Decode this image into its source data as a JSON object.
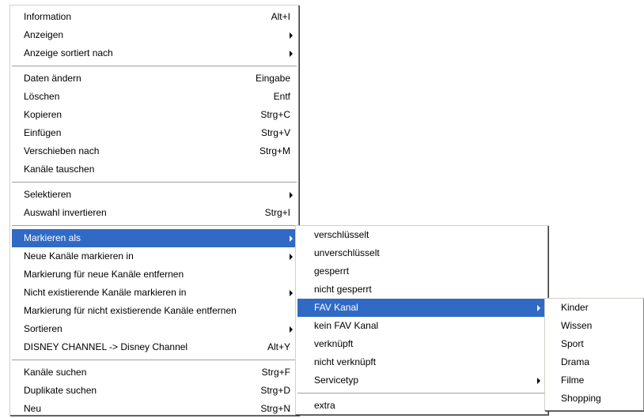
{
  "main_menu": {
    "groups": [
      [
        {
          "label": "Information",
          "shortcut": "Alt+I",
          "submenu": false
        },
        {
          "label": "Anzeigen",
          "shortcut": "",
          "submenu": true
        },
        {
          "label": "Anzeige sortiert nach",
          "shortcut": "",
          "submenu": true
        }
      ],
      [
        {
          "label": "Daten ändern",
          "shortcut": "Eingabe",
          "submenu": false
        },
        {
          "label": "Löschen",
          "shortcut": "Entf",
          "submenu": false
        },
        {
          "label": "Kopieren",
          "shortcut": "Strg+C",
          "submenu": false
        },
        {
          "label": "Einfügen",
          "shortcut": "Strg+V",
          "submenu": false
        },
        {
          "label": "Verschieben nach",
          "shortcut": "Strg+M",
          "submenu": false
        },
        {
          "label": "Kanäle tauschen",
          "shortcut": "",
          "submenu": false
        }
      ],
      [
        {
          "label": "Selektieren",
          "shortcut": "",
          "submenu": true
        },
        {
          "label": "Auswahl invertieren",
          "shortcut": "Strg+I",
          "submenu": false
        }
      ],
      [
        {
          "label": "Markieren als",
          "shortcut": "",
          "submenu": true,
          "highlighted": true
        },
        {
          "label": "Neue Kanäle markieren in",
          "shortcut": "",
          "submenu": true
        },
        {
          "label": "Markierung für neue Kanäle entfernen",
          "shortcut": "",
          "submenu": false
        },
        {
          "label": "Nicht existierende Kanäle markieren in",
          "shortcut": "",
          "submenu": true
        },
        {
          "label": "Markierung für nicht existierende Kanäle entfernen",
          "shortcut": "",
          "submenu": false
        },
        {
          "label": "Sortieren",
          "shortcut": "",
          "submenu": true
        },
        {
          "label": "DISNEY CHANNEL -> Disney Channel",
          "shortcut": "Alt+Y",
          "submenu": false
        }
      ],
      [
        {
          "label": "Kanäle suchen",
          "shortcut": "Strg+F",
          "submenu": false
        },
        {
          "label": "Duplikate suchen",
          "shortcut": "Strg+D",
          "submenu": false
        },
        {
          "label": "Neu",
          "shortcut": "Strg+N",
          "submenu": false
        }
      ]
    ]
  },
  "mark_as_submenu": {
    "groups": [
      [
        {
          "label": "verschlüsselt",
          "submenu": false
        },
        {
          "label": "unverschlüsselt",
          "submenu": false
        },
        {
          "label": "gesperrt",
          "submenu": false
        },
        {
          "label": "nicht gesperrt",
          "submenu": false
        },
        {
          "label": "FAV Kanal",
          "submenu": true,
          "highlighted": true
        },
        {
          "label": "kein FAV Kanal",
          "submenu": false
        },
        {
          "label": "verknüpft",
          "submenu": false
        },
        {
          "label": "nicht verknüpft",
          "submenu": false
        },
        {
          "label": "Servicetyp",
          "submenu": true
        }
      ],
      [
        {
          "label": "extra",
          "submenu": false
        }
      ]
    ]
  },
  "fav_submenu": {
    "items": [
      {
        "label": "Kinder"
      },
      {
        "label": "Wissen"
      },
      {
        "label": "Sport"
      },
      {
        "label": "Drama"
      },
      {
        "label": "Filme"
      },
      {
        "label": "Shopping"
      }
    ]
  },
  "colors": {
    "highlight": "#316ac5",
    "separator": "#a0a0a0",
    "menu_bg": "#ffffff"
  }
}
